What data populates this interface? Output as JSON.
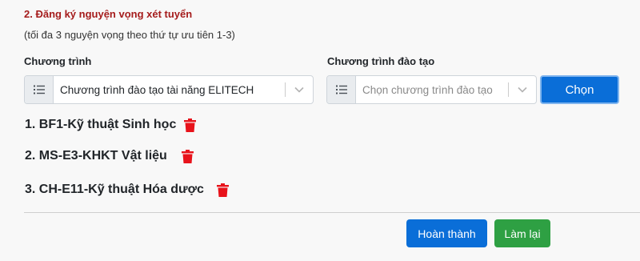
{
  "section": {
    "title": "2. Đăng ký nguyện vọng xét tuyển",
    "subtitle": "(tối đa 3 nguyện vọng theo thứ tự ưu tiên 1-3)"
  },
  "program": {
    "label": "Chương trình",
    "value": "Chương trình đào tạo tài năng ELITECH"
  },
  "training_program": {
    "label": "Chương trình đào tạo",
    "placeholder": "Chọn chương trình đào tạo"
  },
  "select_button": "Chọn",
  "choices": [
    {
      "text": "1. BF1-Kỹ thuật Sinh học"
    },
    {
      "text": "2. MS-E3-KHKT Vật liệu"
    },
    {
      "text": "3. CH-E11-Kỹ thuật Hóa dược"
    }
  ],
  "actions": {
    "finish": "Hoàn thành",
    "reset": "Làm lại"
  },
  "colors": {
    "title": "#a51c1c",
    "primary": "#0a6ed8",
    "success": "#2ea043",
    "delete": "#e8131b"
  },
  "icons": {
    "select_prefix": "list-icon",
    "select_caret": "chevron-down-icon",
    "delete": "trash-icon"
  }
}
